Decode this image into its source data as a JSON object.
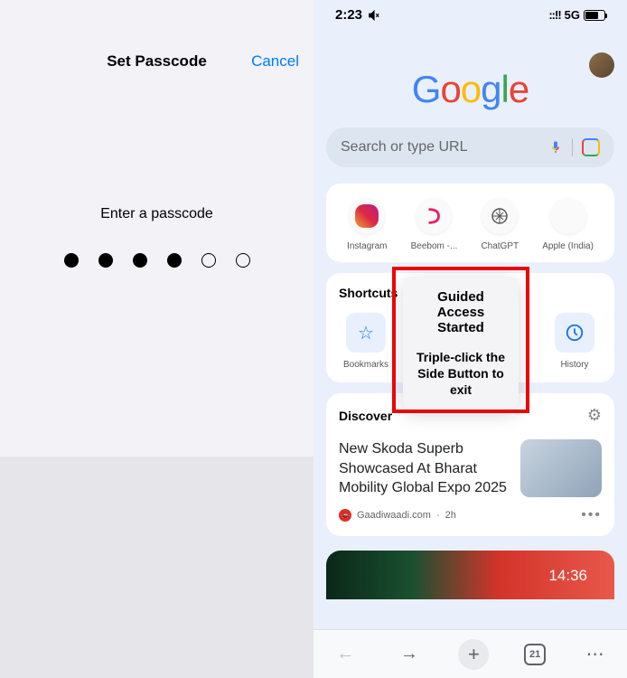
{
  "left": {
    "title": "Set Passcode",
    "cancel": "Cancel",
    "prompt": "Enter a passcode",
    "filled_dots": 4,
    "total_dots": 6
  },
  "right": {
    "status": {
      "time": "2:23",
      "network": "5G",
      "signal": "::!!"
    },
    "logo": {
      "g": "G",
      "o1": "o",
      "o2": "o",
      "g2": "g",
      "l": "l",
      "e": "e"
    },
    "search_placeholder": "Search or type URL",
    "apps": [
      {
        "label": "Instagram"
      },
      {
        "label": "Beebom -..."
      },
      {
        "label": "ChatGPT"
      },
      {
        "label": "Apple (India)"
      }
    ],
    "shortcuts": {
      "title": "Shortcuts",
      "items": [
        {
          "icon": "☆",
          "label": "Bookmarks"
        },
        {
          "icon": "",
          "label": ""
        },
        {
          "icon": "",
          "label": ""
        },
        {
          "icon": "↻",
          "label": "History"
        }
      ]
    },
    "popup": {
      "title": "Guided Access Started",
      "text": "Triple-click the Side Button to exit"
    },
    "discover": {
      "title": "Discover",
      "news": {
        "title": "New Skoda Superb Showcased At Bharat Mobility Global Expo 2025",
        "source": "Gaadiwaadi.com",
        "time": "2h"
      }
    },
    "preview_time": "14:36",
    "tab_count": "21"
  }
}
